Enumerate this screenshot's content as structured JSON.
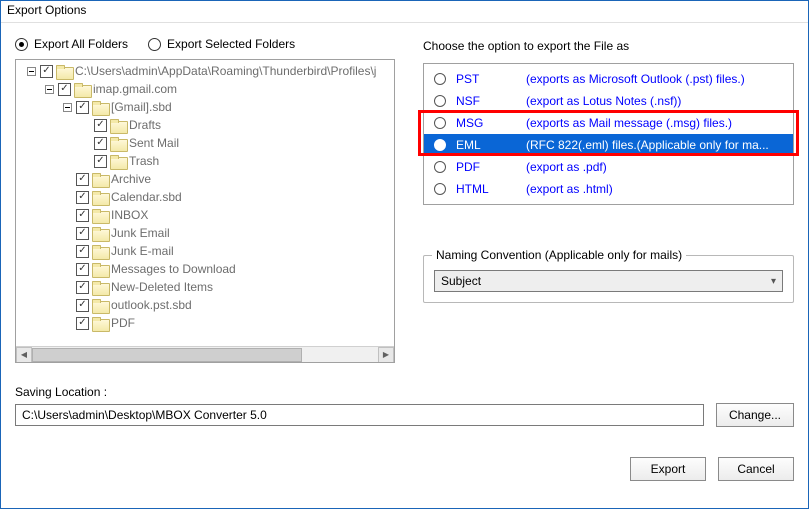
{
  "window": {
    "title": "Export Options"
  },
  "modeRadios": {
    "all": "Export All Folders",
    "selected": "Export Selected Folders",
    "value": "all"
  },
  "tree": {
    "rootPath": "C:\\Users\\admin\\AppData\\Roaming\\Thunderbird\\Profiles\\j",
    "nodes": [
      {
        "depth": 0,
        "expander": "minus",
        "checked": true,
        "label": "C:\\Users\\admin\\AppData\\Roaming\\Thunderbird\\Profiles\\j"
      },
      {
        "depth": 1,
        "expander": "minus",
        "checked": true,
        "label": "imap.gmail.com"
      },
      {
        "depth": 2,
        "expander": "minus",
        "checked": true,
        "label": "[Gmail].sbd"
      },
      {
        "depth": 3,
        "expander": "none",
        "checked": true,
        "label": "Drafts"
      },
      {
        "depth": 3,
        "expander": "none",
        "checked": true,
        "label": "Sent Mail"
      },
      {
        "depth": 3,
        "expander": "none",
        "checked": true,
        "label": "Trash"
      },
      {
        "depth": 2,
        "expander": "none",
        "checked": true,
        "label": "Archive"
      },
      {
        "depth": 2,
        "expander": "none",
        "checked": true,
        "label": "Calendar.sbd"
      },
      {
        "depth": 2,
        "expander": "none",
        "checked": true,
        "label": "INBOX"
      },
      {
        "depth": 2,
        "expander": "none",
        "checked": true,
        "label": "Junk Email"
      },
      {
        "depth": 2,
        "expander": "none",
        "checked": true,
        "label": "Junk E-mail"
      },
      {
        "depth": 2,
        "expander": "none",
        "checked": true,
        "label": "Messages to Download"
      },
      {
        "depth": 2,
        "expander": "none",
        "checked": true,
        "label": "New-Deleted Items"
      },
      {
        "depth": 2,
        "expander": "none",
        "checked": true,
        "label": "outlook.pst.sbd"
      },
      {
        "depth": 2,
        "expander": "none",
        "checked": true,
        "label": "PDF"
      }
    ]
  },
  "formatHeading": "Choose the option to export the File as",
  "formats": [
    {
      "name": "PST",
      "desc": "(exports as Microsoft Outlook (.pst) files.)",
      "selected": false
    },
    {
      "name": "NSF",
      "desc": "(export as Lotus Notes (.nsf))",
      "selected": false
    },
    {
      "name": "MSG",
      "desc": "(exports as Mail message (.msg) files.)",
      "selected": false
    },
    {
      "name": "EML",
      "desc": "(RFC 822(.eml) files.(Applicable only for ma...",
      "selected": true
    },
    {
      "name": "PDF",
      "desc": "(export as .pdf)",
      "selected": false
    },
    {
      "name": "HTML",
      "desc": "(export as .html)",
      "selected": false
    }
  ],
  "naming": {
    "legend": "Naming Convention (Applicable only for mails)",
    "value": "Subject"
  },
  "saving": {
    "label": "Saving Location :",
    "path": "C:\\Users\\admin\\Desktop\\MBOX Converter 5.0",
    "changeBtn": "Change..."
  },
  "footer": {
    "export": "Export",
    "cancel": "Cancel"
  }
}
